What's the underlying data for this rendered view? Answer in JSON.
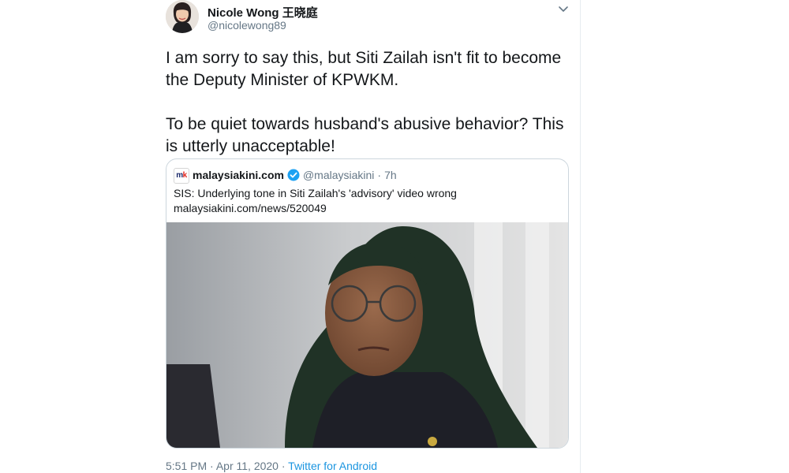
{
  "author": {
    "name": "Nicole Wong 王晓庭",
    "handle": "@nicolewong89"
  },
  "tweet": {
    "paragraphs": [
      "I am sorry to say this, but Siti Zailah isn't fit to become the Deputy Minister of KPWKM.",
      "To be quiet towards husband's abusive behavior? This is utterly unacceptable!"
    ]
  },
  "quote": {
    "logo_text_m": "m",
    "logo_text_k": "k",
    "name": "malaysiakini.com",
    "handle": "@malaysiakini",
    "separator": "·",
    "time": "7h",
    "text_line1": "SIS: Underlying tone in Siti Zailah's 'advisory' video wrong",
    "text_line2": "malaysiakini.com/news/520049"
  },
  "meta": {
    "time": "5:51 PM",
    "separator": "·",
    "date": "Apr 11, 2020",
    "source": "Twitter for Android"
  },
  "icons": {
    "menu": "chevron-down-icon",
    "verified": "verified-badge-icon"
  },
  "colors": {
    "link": "#1b95e0",
    "secondary_text": "#657786",
    "border": "#ccd6dd"
  }
}
